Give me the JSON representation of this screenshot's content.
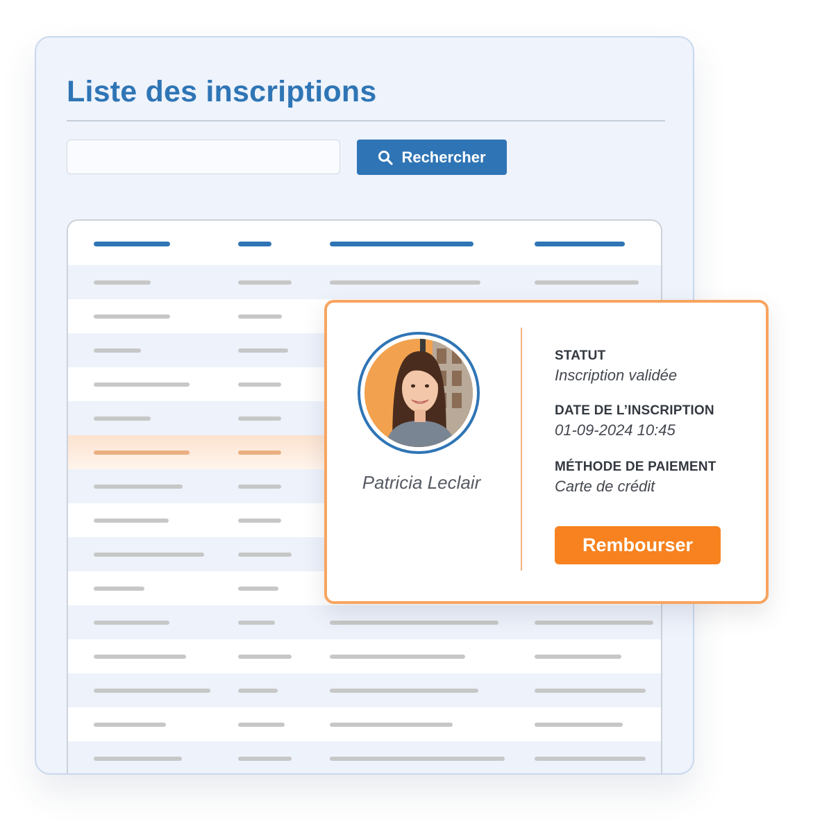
{
  "page": {
    "title": "Liste des inscriptions"
  },
  "search": {
    "value": "",
    "placeholder": "",
    "button_label": "Rechercher",
    "button_icon": "search-icon"
  },
  "table": {
    "column_count": 4,
    "visible_rows": 15,
    "selected_row": 6,
    "note": "cell contents are rendered as gray placeholder lines"
  },
  "detail": {
    "name": "Patricia Leclair",
    "avatar": "avatar-photo",
    "fields": [
      {
        "label": "STATUT",
        "value": "Inscription validée"
      },
      {
        "label": "DATE DE L’INSCRIPTION",
        "value": "01-09-2024 10:45"
      },
      {
        "label": "MÉTHODE DE PAIEMENT",
        "value": "Carte de crédit"
      }
    ],
    "refund_label": "Rembourser"
  },
  "colors": {
    "primary": "#2f75b5",
    "accent": "#f7821f",
    "card_border": "#f8a45f",
    "panel_background": "#eef3fc"
  }
}
